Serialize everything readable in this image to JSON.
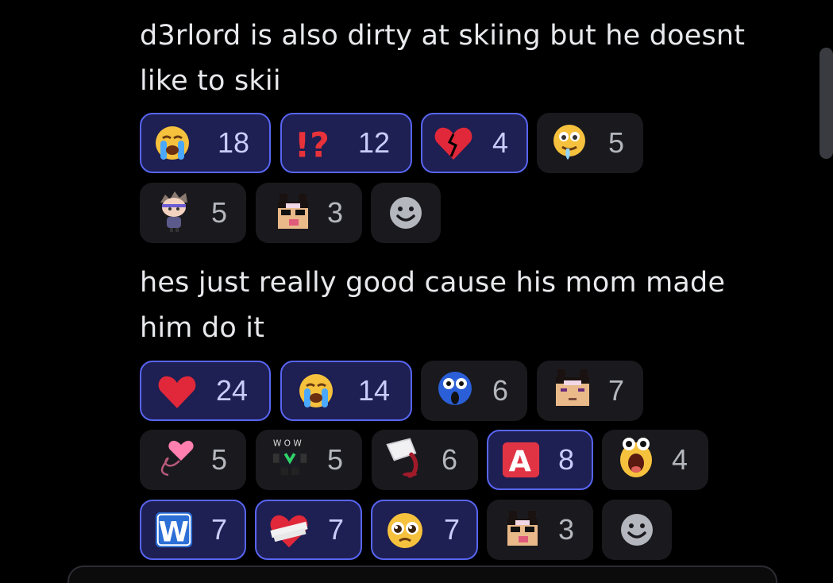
{
  "messages": [
    {
      "text": "d3rlord is also dirty at skiing but he doesnt like to skii",
      "reactions": [
        {
          "emoji": "loudly-crying-face",
          "count": "18",
          "me": true
        },
        {
          "emoji": "interrobang",
          "count": "12",
          "me": true
        },
        {
          "emoji": "broken-heart",
          "count": "4",
          "me": true
        },
        {
          "emoji": "drooling-face",
          "count": "5",
          "me": false
        },
        {
          "emoji": "anime-character-sticker",
          "count": "5",
          "me": false
        },
        {
          "emoji": "sunglasses-block-face",
          "count": "3",
          "me": false
        }
      ]
    },
    {
      "text": "hes just really good cause his mom made him do it",
      "reactions": [
        {
          "emoji": "red-heart",
          "count": "24",
          "me": true
        },
        {
          "emoji": "loudly-crying-face",
          "count": "14",
          "me": true
        },
        {
          "emoji": "shocked-blue-face",
          "count": "6",
          "me": false
        },
        {
          "emoji": "block-face",
          "count": "7",
          "me": false
        },
        {
          "emoji": "heart-balloon",
          "count": "5",
          "me": false
        },
        {
          "emoji": "wow-sticker",
          "count": "5",
          "me": false
        },
        {
          "emoji": "spilling-cup",
          "count": "6",
          "me": false
        },
        {
          "emoji": "letter-a-button",
          "count": "8",
          "me": true
        },
        {
          "emoji": "screaming-yellow-face",
          "count": "4",
          "me": false
        },
        {
          "emoji": "letter-w-button",
          "count": "7",
          "me": true
        },
        {
          "emoji": "bandaged-heart",
          "count": "7",
          "me": true
        },
        {
          "emoji": "pleading-face",
          "count": "7",
          "me": true
        },
        {
          "emoji": "sunglasses-block-face",
          "count": "3",
          "me": false
        }
      ]
    }
  ],
  "colors": {
    "background": "#000000",
    "pill": "#1a1a1e",
    "pill_selected": "#1e1f52",
    "pill_selected_border": "#5865f2"
  }
}
